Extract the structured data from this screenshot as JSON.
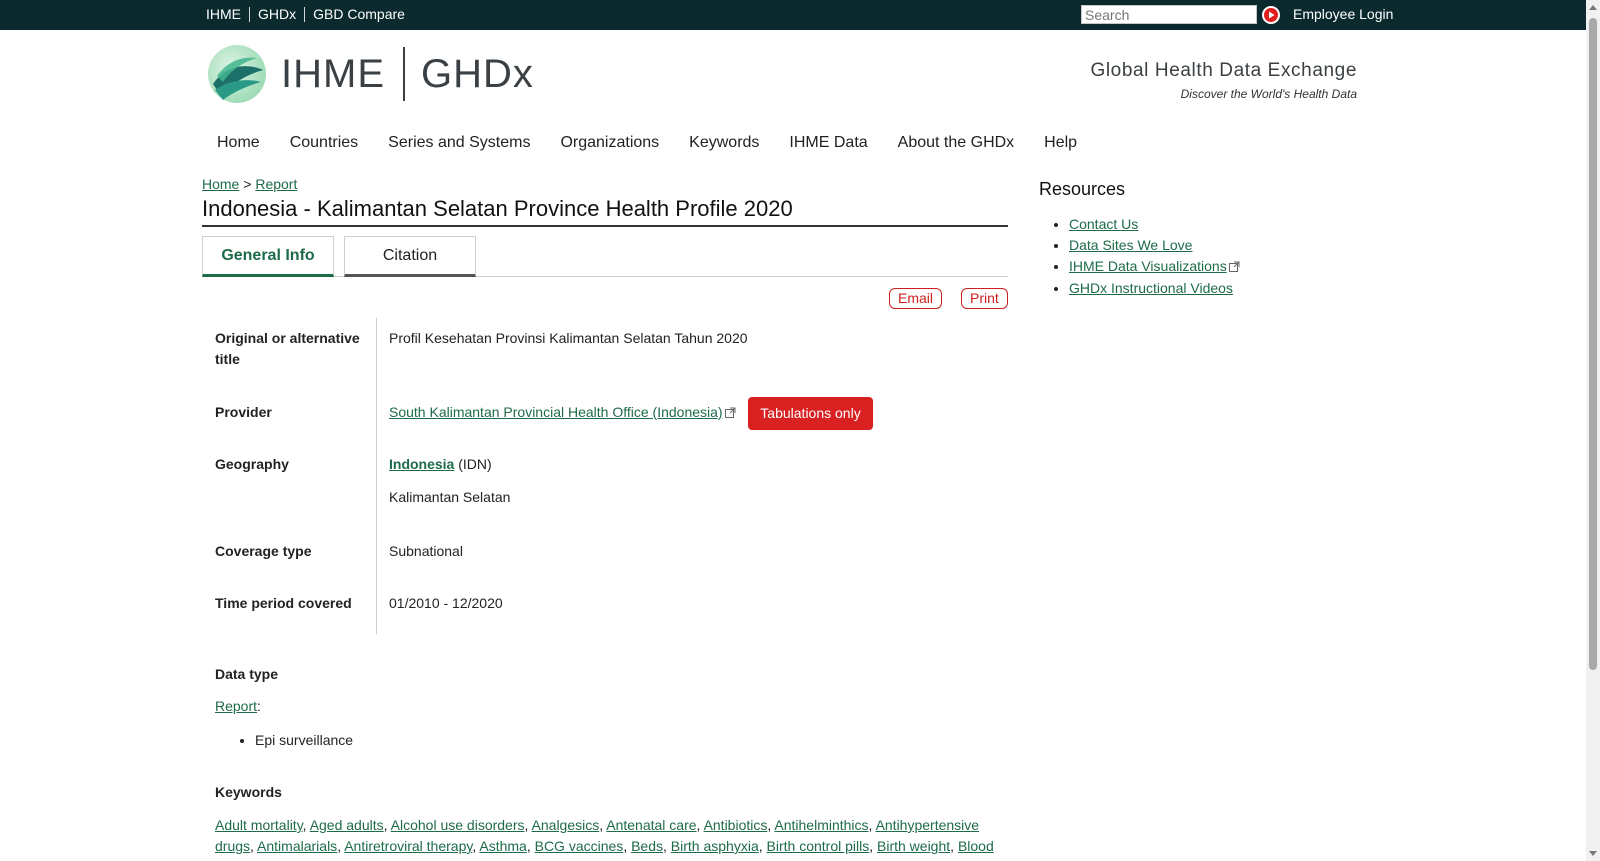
{
  "topbar": {
    "links": [
      "IHME",
      "GHDx",
      "GBD Compare"
    ],
    "search_placeholder": "Search",
    "employee_login": "Employee Login"
  },
  "header": {
    "logo_ihme": "IHME",
    "logo_ghdx": "GHDx",
    "tagline_title": "Global Health Data Exchange",
    "tagline_sub": "Discover the World's Health Data"
  },
  "nav": [
    "Home",
    "Countries",
    "Series and Systems",
    "Organizations",
    "Keywords",
    "IHME Data",
    "About the GHDx",
    "Help"
  ],
  "breadcrumb": {
    "home": "Home",
    "sep": ">",
    "report": "Report"
  },
  "page_title": "Indonesia - Kalimantan Selatan Province Health Profile 2020",
  "tabs": [
    "General Info",
    "Citation"
  ],
  "actions": {
    "email": "Email",
    "print": "Print"
  },
  "details": {
    "orig_title_label": "Original or alternative title",
    "orig_title_value": "Profil Kesehatan Provinsi Kalimantan Selatan Tahun 2020",
    "provider_label": "Provider",
    "provider_value": "South Kalimantan Provincial Health Office (Indonesia)",
    "provider_badge": "Tabulations only",
    "geography_label": "Geography",
    "geography_country": "Indonesia",
    "geography_code": "(IDN)",
    "geography_sub": "Kalimantan Selatan",
    "coverage_label": "Coverage type",
    "coverage_value": "Subnational",
    "time_label": "Time period covered",
    "time_value": "01/2010 - 12/2020"
  },
  "data_type": {
    "heading": "Data type",
    "type_link": "Report",
    "items": [
      "Epi surveillance"
    ]
  },
  "keywords": {
    "heading": "Keywords",
    "items": [
      "Adult mortality",
      "Aged adults",
      "Alcohol use disorders",
      "Analgesics",
      "Antenatal care",
      "Antibiotics",
      "Antihelminthics",
      "Antihypertensive drugs",
      "Antimalarials",
      "Antiretroviral therapy",
      "Asthma",
      "BCG vaccines",
      "Beds",
      "Birth asphyxia",
      "Birth control pills",
      "Birth weight",
      "Blood"
    ]
  },
  "sidebar": {
    "title": "Resources",
    "links": [
      "Contact Us",
      "Data Sites We Love",
      "IHME Data Visualizations",
      "GHDx Instructional Videos"
    ]
  },
  "colors": {
    "topbar_bg": "#0b2a2d",
    "link_green": "#1e6b4a",
    "badge_red": "#d92121"
  }
}
